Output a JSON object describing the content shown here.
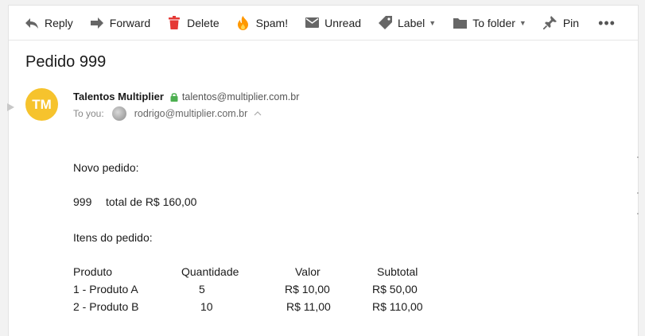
{
  "toolbar": {
    "reply": "Reply",
    "forward": "Forward",
    "delete": "Delete",
    "spam": "Spam!",
    "unread": "Unread",
    "label": "Label",
    "to_folder": "To folder",
    "pin": "Pin",
    "more": "•••"
  },
  "message": {
    "subject": "Pedido 999",
    "avatar_initials": "TM",
    "avatar_color": "#f6c32d",
    "from_name": "Talentos Multiplier",
    "from_email": "talentos@multiplier.com.br",
    "to_label": "To you:",
    "to_email": "rodrigo@multiplier.com.br"
  },
  "body": {
    "heading": "Novo pedido:",
    "order_number": "999",
    "order_total": "total de R$ 160,00",
    "items_heading": "Itens do pedido:",
    "columns": [
      "Produto",
      "Quantidade",
      "Valor",
      "Subtotal"
    ],
    "rows": [
      [
        "1 - Produto A",
        "5",
        "R$ 10,00",
        "R$ 50,00"
      ],
      [
        "2 - Produto B",
        "10",
        "R$ 11,00",
        "R$ 110,00"
      ]
    ]
  },
  "colors": {
    "delete_red": "#e53935",
    "spam_orange": "#ff9800",
    "lock_green": "#4caf50"
  }
}
